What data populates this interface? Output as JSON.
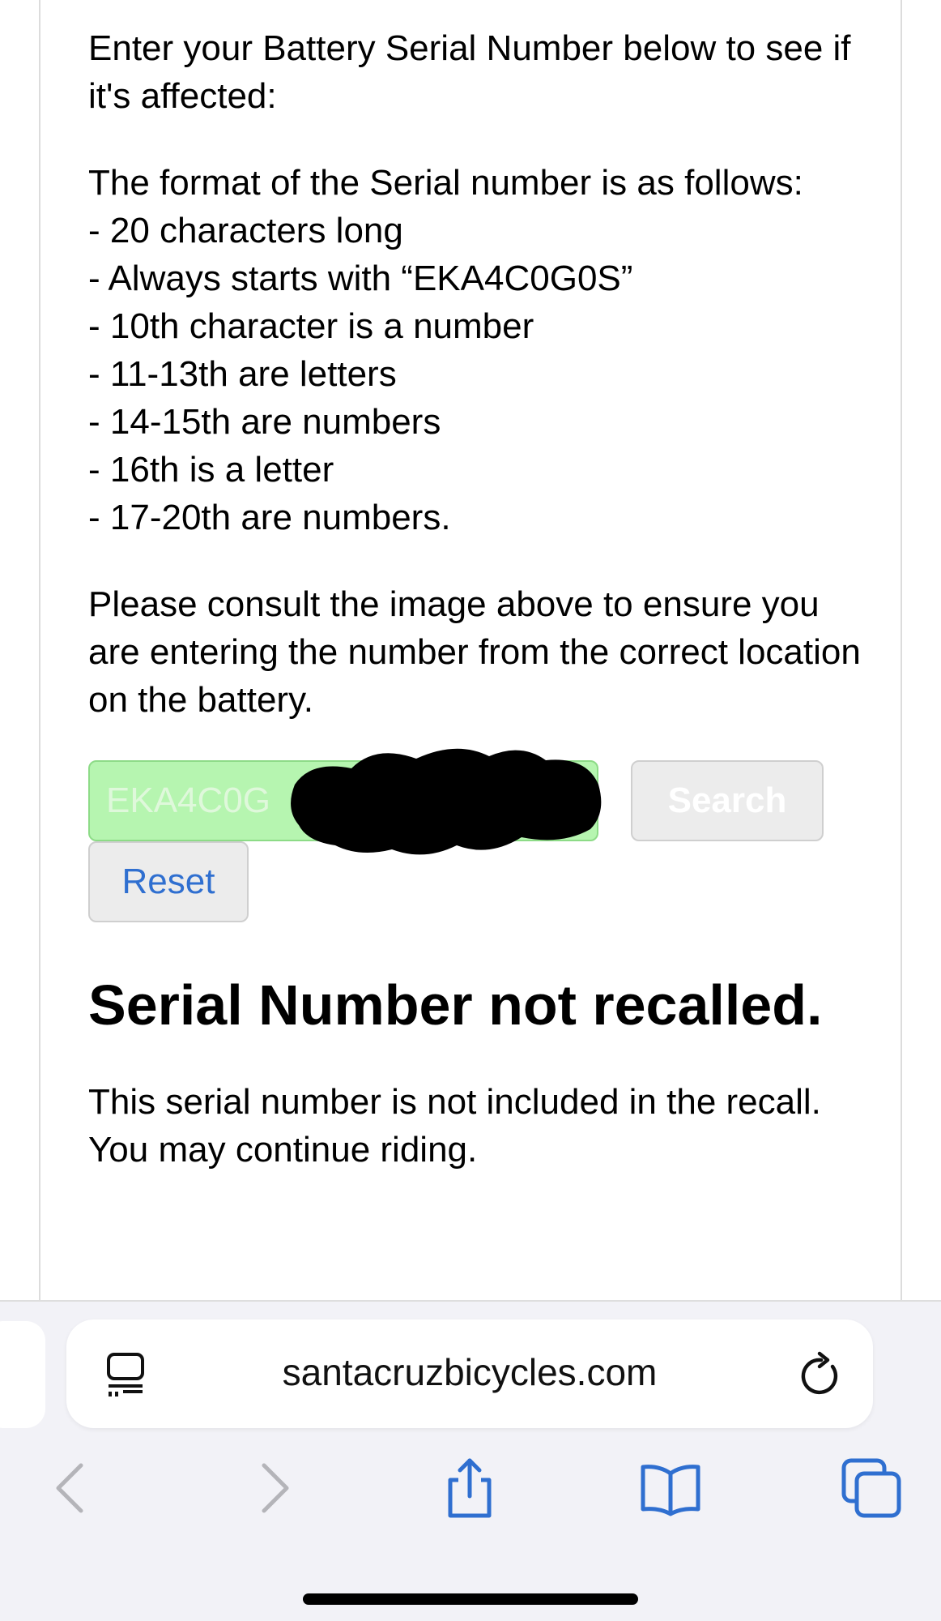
{
  "instructions": {
    "intro": "Enter your Battery Serial Number below to see if it's affected:",
    "format_heading": "The format of the Serial number is as follows:",
    "format_rules": [
      "- 20 characters long",
      "- Always starts with “EKA4C0G0S”",
      "- 10th character is a number",
      "- 11-13th are letters",
      "- 14-15th are numbers",
      "- 16th is a letter",
      "- 17-20th are numbers."
    ],
    "consult_note": "Please consult the image above to ensure you are entering the number from the correct location on the battery."
  },
  "form": {
    "serial_value": "EKA4C0G",
    "search_label": "Search",
    "reset_label": "Reset",
    "input_color": "#b6f5b0"
  },
  "result": {
    "title": "Serial Number not recalled.",
    "message": "This serial number is not included in the recall. You may continue riding."
  },
  "browser": {
    "url": "santacruzbicycles.com",
    "accent_color": "#2f6fd0",
    "icons": [
      "reader-icon",
      "reload-icon",
      "back-icon",
      "forward-icon",
      "share-icon",
      "bookmarks-icon",
      "tabs-icon"
    ]
  }
}
